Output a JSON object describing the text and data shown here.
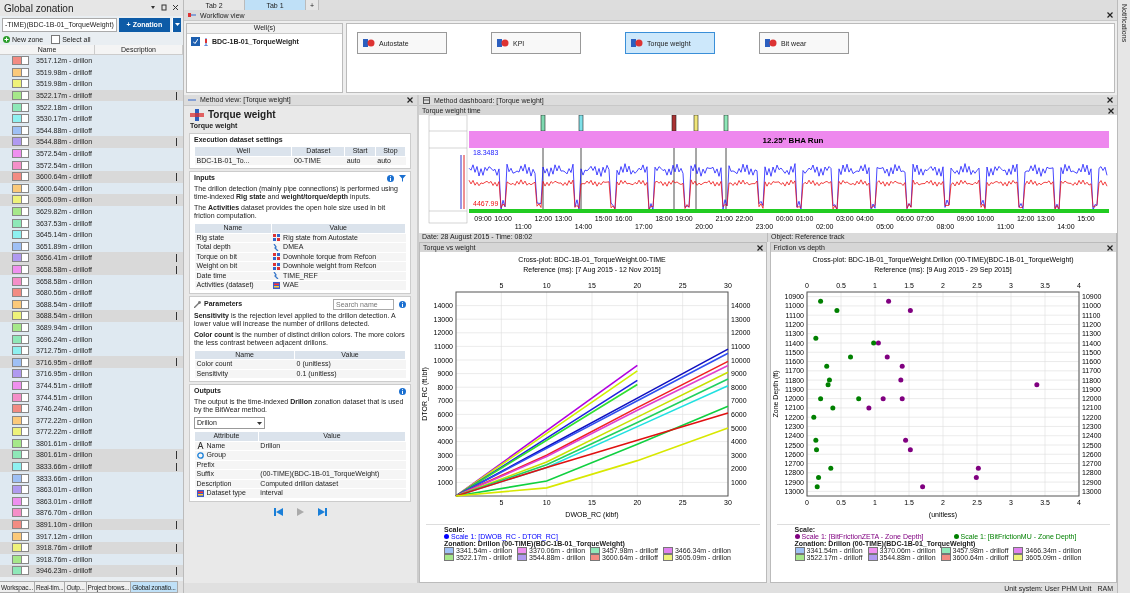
{
  "top_tabs": [
    {
      "label": "Tab 2",
      "selected": false
    },
    {
      "label": "Tab 1",
      "selected": true
    },
    {
      "label": "+",
      "selected": false
    }
  ],
  "global_zonation": {
    "title": "Global zonation",
    "dataset": "-TIME)(BDC-1B-01_TorqueWeight)",
    "add_button": "+ Zonation",
    "new_zone": "New zone",
    "select_all": {
      "label": "Select all",
      "checked": false
    },
    "columns": [
      "Name",
      "Description"
    ],
    "zones": [
      {
        "name": "3517.12m - drillon",
        "color": "#f28b82",
        "selected": false
      },
      {
        "name": "3519.98m - drilloff",
        "color": "#fbc97a",
        "selected": false
      },
      {
        "name": "3519.98m - drillon",
        "color": "#eef27a",
        "selected": false
      },
      {
        "name": "3522.17m - drilloff",
        "color": "#a6e88a",
        "selected": true
      },
      {
        "name": "3522.18m - drillon",
        "color": "#8ee8b8",
        "selected": false
      },
      {
        "name": "3530.17m - drilloff",
        "color": "#8ef0f0",
        "selected": false
      },
      {
        "name": "3544.88m - drilloff",
        "color": "#9ec0f5",
        "selected": false
      },
      {
        "name": "3544.88m - drillon",
        "color": "#b09af0",
        "selected": true
      },
      {
        "name": "3572.54m - drilloff",
        "color": "#ef90ef",
        "selected": false
      },
      {
        "name": "3572.54m - drillon",
        "color": "#f58fc8",
        "selected": false
      },
      {
        "name": "3600.64m - drilloff",
        "color": "#f28b82",
        "selected": true
      },
      {
        "name": "3600.64m - drillon",
        "color": "#fbc97a",
        "selected": false
      },
      {
        "name": "3605.09m - drillon",
        "color": "#eef27a",
        "selected": true
      },
      {
        "name": "3629.82m - drillon",
        "color": "#a6e88a",
        "selected": false
      },
      {
        "name": "3637.53m - drilloff",
        "color": "#8ee8b8",
        "selected": false
      },
      {
        "name": "3645.14m - drillon",
        "color": "#8ef0f0",
        "selected": false
      },
      {
        "name": "3651.89m - drillon",
        "color": "#9ec0f5",
        "selected": false
      },
      {
        "name": "3656.41m - drilloff",
        "color": "#b09af0",
        "selected": true
      },
      {
        "name": "3658.58m - drilloff",
        "color": "#ef90ef",
        "selected": true
      },
      {
        "name": "3658.58m - drillon",
        "color": "#f58fc8",
        "selected": false
      },
      {
        "name": "3680.56m - drilloff",
        "color": "#f28b82",
        "selected": false
      },
      {
        "name": "3688.54m - drilloff",
        "color": "#fbc97a",
        "selected": false
      },
      {
        "name": "3688.54m - drillon",
        "color": "#eef27a",
        "selected": true
      },
      {
        "name": "3689.94m - drillon",
        "color": "#a6e88a",
        "selected": false
      },
      {
        "name": "3696.24m - drillon",
        "color": "#8ee8b8",
        "selected": false
      },
      {
        "name": "3712.75m - drilloff",
        "color": "#8ef0f0",
        "selected": false
      },
      {
        "name": "3716.95m - drilloff",
        "color": "#9ec0f5",
        "selected": true
      },
      {
        "name": "3716.95m - drillon",
        "color": "#b09af0",
        "selected": false
      },
      {
        "name": "3744.51m - drilloff",
        "color": "#ef90ef",
        "selected": false
      },
      {
        "name": "3744.51m - drillon",
        "color": "#f58fc8",
        "selected": false
      },
      {
        "name": "3746.24m - drillon",
        "color": "#f28b82",
        "selected": false
      },
      {
        "name": "3772.22m - drillon",
        "color": "#fbc97a",
        "selected": false
      },
      {
        "name": "3772.22m - drilloff",
        "color": "#eef27a",
        "selected": false
      },
      {
        "name": "3801.61m - drilloff",
        "color": "#a6e88a",
        "selected": false
      },
      {
        "name": "3801.61m - drillon",
        "color": "#8ee8b8",
        "selected": true
      },
      {
        "name": "3833.66m - drilloff",
        "color": "#8ef0f0",
        "selected": true
      },
      {
        "name": "3833.66m - drillon",
        "color": "#9ec0f5",
        "selected": false
      },
      {
        "name": "3863.01m - drillon",
        "color": "#b09af0",
        "selected": false
      },
      {
        "name": "3863.01m - drilloff",
        "color": "#ef90ef",
        "selected": false
      },
      {
        "name": "3876.70m - drillon",
        "color": "#f58fc8",
        "selected": false
      },
      {
        "name": "3891.10m - drillon",
        "color": "#f28b82",
        "selected": true
      },
      {
        "name": "3917.12m - drillon",
        "color": "#fbc97a",
        "selected": false
      },
      {
        "name": "3918.76m - drilloff",
        "color": "#eef27a",
        "selected": true
      },
      {
        "name": "3918.76m - drillon",
        "color": "#a6e88a",
        "selected": false
      },
      {
        "name": "3946.23m - drilloff",
        "color": "#8ee8b8",
        "selected": true
      }
    ]
  },
  "bottom_tabs": [
    {
      "label": "Workspac...",
      "selected": false
    },
    {
      "label": "Real-tim...",
      "selected": false
    },
    {
      "label": "Outp...",
      "selected": false
    },
    {
      "label": "Project brows...",
      "selected": false
    },
    {
      "label": "Global zonatio...",
      "selected": true
    }
  ],
  "workflow": {
    "title": "Workflow view",
    "wells_header": "Well(s)",
    "wells": [
      {
        "name": "BDC-1B-01_TorqueWeight",
        "checked": true
      }
    ],
    "nodes": [
      {
        "label": "Autostate",
        "selected": false
      },
      {
        "label": "KPI",
        "selected": false
      },
      {
        "label": "Torque weight",
        "selected": true
      },
      {
        "label": "Bit wear",
        "selected": false
      }
    ]
  },
  "method_view": {
    "title": "Method view: [Torque weight]",
    "method": "Torque weight",
    "subtitle": "Torque weight",
    "execution": {
      "title": "Execution dataset settings",
      "columns": [
        "Well",
        "Dataset",
        "Start",
        "Stop"
      ],
      "row": [
        "BDC-1B-01_To...",
        "00-TIME",
        "auto",
        "auto"
      ]
    },
    "inputs": {
      "title": "Inputs",
      "paragraphs": [
        "The drillon detection (mainly pipe connections) is performed using time-indexed **Rig state** and **weight/torque/depth** inputs.",
        "The **Activities** dataset provides the open hole size used in bit friction computation."
      ],
      "columns": [
        "Name",
        "Value"
      ],
      "rows": [
        {
          "name": "Rig state",
          "value": "Rig state from Autostate",
          "kind": "method"
        },
        {
          "name": "Total depth",
          "value": "DMEA",
          "kind": "curve"
        },
        {
          "name": "Torque on bit",
          "value": "Downhole torque from Refcon",
          "kind": "method"
        },
        {
          "name": "Weight on bit",
          "value": "Downhole weight from Refcon",
          "kind": "method"
        },
        {
          "name": "Date time",
          "value": "TIME_REF",
          "kind": "curve"
        },
        {
          "name": "Activities (dataset)",
          "value": "WAE",
          "kind": "dataset"
        }
      ]
    },
    "parameters": {
      "title": "Parameters",
      "search_placeholder": "Search name",
      "paragraphs": [
        "**Sensitivity** is the rejection level applied to the drillon detection. A lower value will increase the number of drillons detected.",
        "**Color count** is the number of distinct drillon colors. The more colors the less contrast between adjacent drillons."
      ],
      "columns": [
        "Name",
        "Value"
      ],
      "rows": [
        {
          "name": "Color count",
          "value": "0 (unitless)"
        },
        {
          "name": "Sensitivity",
          "value": "0.1 (unitless)"
        }
      ]
    },
    "outputs": {
      "title": "Outputs",
      "paragraphs": [
        "The output is the time-indexed **Drillon** zonation dataset that is used by the BitWear method."
      ],
      "dropdown": "Drillon",
      "columns": [
        "Attribute",
        "Value"
      ],
      "rows": [
        {
          "name": "Name",
          "value": "Drillon",
          "kind": "name"
        },
        {
          "name": "Group",
          "kind": "group"
        },
        {
          "name": "Prefix",
          "kind": "plain"
        },
        {
          "name": "Suffix",
          "value": "(00-TIME)(BDC-1B-01_TorqueWeight)",
          "kind": "plain"
        },
        {
          "name": "Description",
          "value": "Computed drillon dataset",
          "kind": "plain"
        },
        {
          "name": "Dataset type",
          "value": "interval",
          "kind": "dataset"
        }
      ]
    }
  },
  "dashboard": {
    "title": "Method dashboard: [Torque weight]",
    "track_title": "Torque weight time",
    "band": "12.25\" BHA Run",
    "readings": [
      "18.3483",
      "4467.99"
    ],
    "times": [
      "09:00",
      "10:00",
      "11:00",
      "12:00",
      "13:00",
      "14:00",
      "15:00",
      "16:00",
      "17:00",
      "18:00",
      "19:00",
      "20:00",
      "21:00",
      "22:00",
      "23:00",
      "00:00",
      "01:00",
      "02:00",
      "03:00",
      "04:00",
      "05:00",
      "06:00",
      "07:00",
      "08:00",
      "09:00",
      "10:00",
      "11:00",
      "12:00",
      "13:00",
      "14:00",
      "15:00"
    ],
    "date": "Date: 28 August 2015 - Time: 08:02",
    "object": "Object: Reference track",
    "plots": [
      {
        "title": "Torque vs weight",
        "reference": "Reference (ms): [7 Aug 2015 - 12 Nov 2015]",
        "bottom_axis_labels": [
          "5",
          "10",
          "15",
          "20",
          "25",
          "30"
        ],
        "right_axis_labels": [
          "14000",
          "13000",
          "12000",
          "11000",
          "10000",
          "9000",
          "8000",
          "7000",
          "6000",
          "5000",
          "4000",
          "3000",
          "2000",
          "1000"
        ],
        "chart_data": {
          "type": "line",
          "title": "Cross-plot: BDC-1B-01_TorqueWeight.00-TIME",
          "xlabel": "DWOB_RC (klbf)",
          "ylabel": "DTOR_RC (ft.lbf)",
          "grid": true,
          "x": [
            0,
            10,
            20,
            30
          ],
          "xlim": [
            0,
            30
          ],
          "ylim": [
            0,
            15000
          ],
          "xticks": [
            5,
            10,
            15,
            20,
            25,
            30
          ],
          "yticks": [
            1000,
            2000,
            3000,
            4000,
            5000,
            6000,
            7000,
            8000,
            9000,
            10000,
            11000,
            12000,
            13000,
            14000
          ],
          "series": [
            {
              "color": "#b000e0",
              "values": [
                0,
                4800,
                9600,
                null
              ]
            },
            {
              "color": "#d0f000",
              "values": [
                0,
                4600,
                9200,
                null
              ]
            },
            {
              "color": "#2020e0",
              "values": [
                0,
                4250,
                8500,
                null
              ]
            },
            {
              "color": "#30e030",
              "values": [
                0,
                4100,
                8200,
                null
              ]
            },
            {
              "color": "#1010c0",
              "values": [
                0,
                3600,
                7200,
                10800
              ]
            },
            {
              "color": "#3050f0",
              "values": [
                0,
                3500,
                7000,
                10500
              ]
            },
            {
              "color": "#f02020",
              "values": [
                0,
                3000,
                6500,
                9900
              ]
            },
            {
              "color": "#e040d0",
              "values": [
                0,
                2900,
                6300,
                9600
              ]
            },
            {
              "color": "#c8e000",
              "values": [
                0,
                2500,
                5800,
                9100
              ]
            },
            {
              "color": "#20d060",
              "values": [
                0,
                2300,
                5400,
                8600
              ]
            },
            {
              "color": "#20e0e0",
              "values": [
                0,
                2100,
                5100,
                8100
              ]
            },
            {
              "color": "#10d040",
              "values": [
                0,
                1100,
                3800,
                6600
              ]
            },
            {
              "color": "#e01010",
              "values": [
                0,
                2100,
                4100,
                6100
              ]
            },
            {
              "color": "#d8e800",
              "values": [
                0,
                600,
                2600,
                5000
              ]
            }
          ]
        },
        "legend": {
          "scale_title": "Scale:",
          "scales": [
            {
              "label": "Scale 1:  [DWOB_RC - DTOR_RC]",
              "color": "#0000ff"
            }
          ],
          "zonation_title": "Zonation: Drillon (00-TIME)(BDC-1B-01_TorqueWeight)",
          "items": [
            {
              "label": "3341.54m - drillon",
              "color": "#9ec0f5"
            },
            {
              "label": "3370.06m - drillon",
              "color": "#ef90ef"
            },
            {
              "label": "3457.98m - drilloff",
              "color": "#8ee8b8"
            },
            {
              "label": "3466.34m - drillon",
              "color": "#e080f0"
            },
            {
              "label": "3522.17m - drilloff",
              "color": "#a6e88a"
            },
            {
              "label": "3544.88m - drillon",
              "color": "#b09af0"
            },
            {
              "label": "3600.64m - drilloff",
              "color": "#f28b82"
            },
            {
              "label": "3605.09m - drillon",
              "color": "#eef27a"
            }
          ]
        }
      },
      {
        "title": "Friction vs depth",
        "reference": "Reference (ms): [9 Aug 2015 - 29 Sep 2015]",
        "bottom_axis_labels": [
          "0",
          "0.5",
          "1",
          "1.5",
          "2",
          "2.5",
          "3",
          "3.5",
          "4"
        ],
        "right_axis_labels": [
          "10900",
          "11000",
          "11100",
          "11200",
          "11300",
          "11400",
          "11500",
          "11600",
          "11700",
          "11800",
          "11900",
          "12000",
          "12100",
          "12200",
          "12300",
          "12400",
          "12500",
          "12600",
          "12700",
          "12800",
          "12900",
          "13000"
        ],
        "chart_data": {
          "type": "scatter",
          "title": "Cross-plot: BDC-1B-01_TorqueWeight.Drillon (00-TIME)(BDC-1B-01_TorqueWeight)",
          "xlabel": "(unitless)",
          "ylabel": "Zone Depth (ft)",
          "grid": true,
          "xlim": [
            0,
            4
          ],
          "ylim": [
            13050,
            10850
          ],
          "xticks": [
            0,
            0.5,
            1,
            1.5,
            2,
            2.5,
            3,
            3.5,
            4
          ],
          "yticks": [
            10900,
            11000,
            11100,
            11200,
            11300,
            11400,
            11500,
            11600,
            11700,
            11800,
            11900,
            12000,
            12100,
            12200,
            12300,
            12400,
            12500,
            12600,
            12700,
            12800,
            12900,
            13000
          ],
          "series": [
            {
              "color": "#800080",
              "x": [
                1.2,
                1.52,
                1.05,
                1.18,
                1.4,
                1.38,
                3.38,
                1.12,
                1.4,
                0.91,
                1.45,
                1.52,
                2.52,
                2.49,
                1.7
              ],
              "values": [
                10950,
                11050,
                11400,
                11550,
                11650,
                11800,
                11850,
                12000,
                12000,
                12100,
                12450,
                12550,
                12750,
                12850,
                12950
              ]
            },
            {
              "color": "#008000",
              "x": [
                0.2,
                0.44,
                0.13,
                0.98,
                0.64,
                0.29,
                0.33,
                0.31,
                0.2,
                0.76,
                0.38,
                0.1,
                0.13,
                0.14,
                0.35,
                0.17,
                0.15
              ],
              "values": [
                10950,
                11050,
                11350,
                11400,
                11550,
                11650,
                11800,
                11850,
                12000,
                12000,
                12100,
                12200,
                12450,
                12550,
                12750,
                12850,
                12950
              ]
            }
          ]
        },
        "legend": {
          "scale_title": "Scale:",
          "scales": [
            {
              "label": "Scale 1:  [BitFrictionZETA - Zone Depth]",
              "color": "#800080"
            },
            {
              "label": "Scale 1:  [BitFrictionMU - Zone Depth]",
              "color": "#008000"
            }
          ],
          "zonation_title": "Zonation: Drillon (00-TIME)(BDC-1B-01_TorqueWeight)",
          "items": [
            {
              "label": "3341.54m - drillon",
              "color": "#9ec0f5"
            },
            {
              "label": "3370.06m - drillon",
              "color": "#ef90ef"
            },
            {
              "label": "3457.98m - drilloff",
              "color": "#8ee8b8"
            },
            {
              "label": "3466.34m - drillon",
              "color": "#e080f0"
            },
            {
              "label": "3522.17m - drilloff",
              "color": "#a6e88a"
            },
            {
              "label": "3544.88m - drillon",
              "color": "#b09af0"
            },
            {
              "label": "3600.64m - drilloff",
              "color": "#f28b82"
            },
            {
              "label": "3605.09m - drillon",
              "color": "#eef27a"
            }
          ]
        }
      }
    ]
  },
  "notifications": "Notifications",
  "status_bar": {
    "unit_system": "Unit system: User PHM Unit",
    "ram": "RAM"
  }
}
